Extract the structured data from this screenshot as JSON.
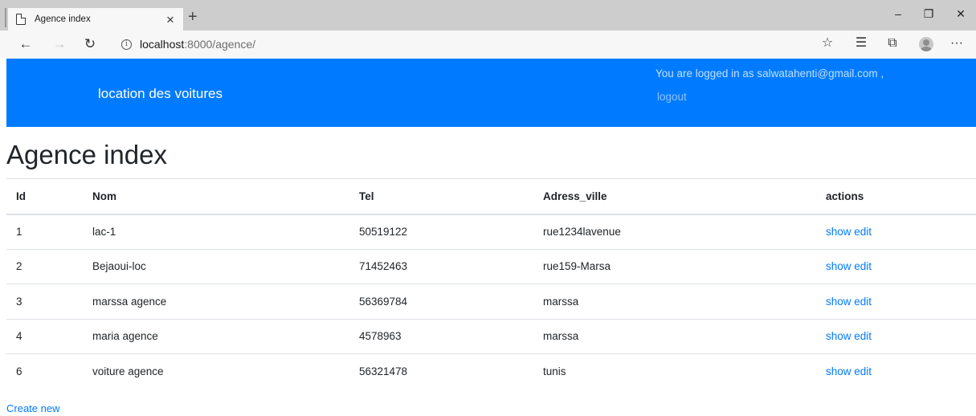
{
  "browser": {
    "tab_title": "Agence index",
    "tab_close": "×",
    "new_tab": "+",
    "url_host": "localhost",
    "url_path": ":8000/agence/",
    "controls": {
      "minimize": "–",
      "restore": "❐",
      "close": "✕"
    },
    "nav": {
      "back": "←",
      "forward": "→",
      "refresh": "↻",
      "info": "i"
    },
    "tools": {
      "favorite": "☆",
      "favorites_list": "☰",
      "collections": "⧉",
      "more": "···"
    }
  },
  "navbar": {
    "brand": "location des voitures",
    "logged_in_text": "You are logged in as salwatahenti@gmail.com ,",
    "logout": "logout",
    "color": "#007bff"
  },
  "page": {
    "title": "Agence index",
    "create_new": "Create new"
  },
  "table": {
    "headers": [
      "Id",
      "Nom",
      "Tel",
      "Adress_ville",
      "actions"
    ],
    "rows": [
      {
        "id": "1",
        "nom": "lac-1",
        "tel": "50519122",
        "adress_ville": "rue1234lavenue",
        "show": "show",
        "edit": "edit"
      },
      {
        "id": "2",
        "nom": "Bejaoui-loc",
        "tel": "71452463",
        "adress_ville": "rue159-Marsa",
        "show": "show",
        "edit": "edit"
      },
      {
        "id": "3",
        "nom": "marssa agence",
        "tel": "56369784",
        "adress_ville": "marssa",
        "show": "show",
        "edit": "edit"
      },
      {
        "id": "4",
        "nom": "maria agence",
        "tel": "4578963",
        "adress_ville": "marssa",
        "show": "show",
        "edit": "edit"
      },
      {
        "id": "6",
        "nom": "voiture agence",
        "tel": "56321478",
        "adress_ville": "tunis",
        "show": "show",
        "edit": "edit"
      }
    ]
  },
  "colors": {
    "link": "#007bff",
    "text": "#212529",
    "border": "#dee2e6"
  }
}
